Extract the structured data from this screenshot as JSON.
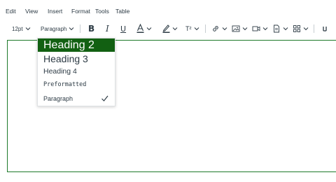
{
  "menubar": {
    "items": [
      "Edit",
      "View",
      "Insert",
      "Format",
      "Tools",
      "Table"
    ]
  },
  "toolbar": {
    "font_size": "12pt",
    "block_format": "Paragraph",
    "bold_glyph": "B",
    "italic_glyph": "I",
    "underline_glyph": "U",
    "text_color_glyph": "A",
    "superscript_glyph": "T²"
  },
  "dropdown": {
    "items": [
      {
        "label": "Heading 2",
        "selected": false,
        "highlighted": true
      },
      {
        "label": "Heading 3",
        "selected": false
      },
      {
        "label": "Heading 4",
        "selected": false
      },
      {
        "label": "Preformatted",
        "selected": false
      },
      {
        "label": "Paragraph",
        "selected": true
      }
    ]
  },
  "colors": {
    "highlight": "#126012",
    "editor_border": "#1e7a2a",
    "text": "#2d3b45"
  }
}
